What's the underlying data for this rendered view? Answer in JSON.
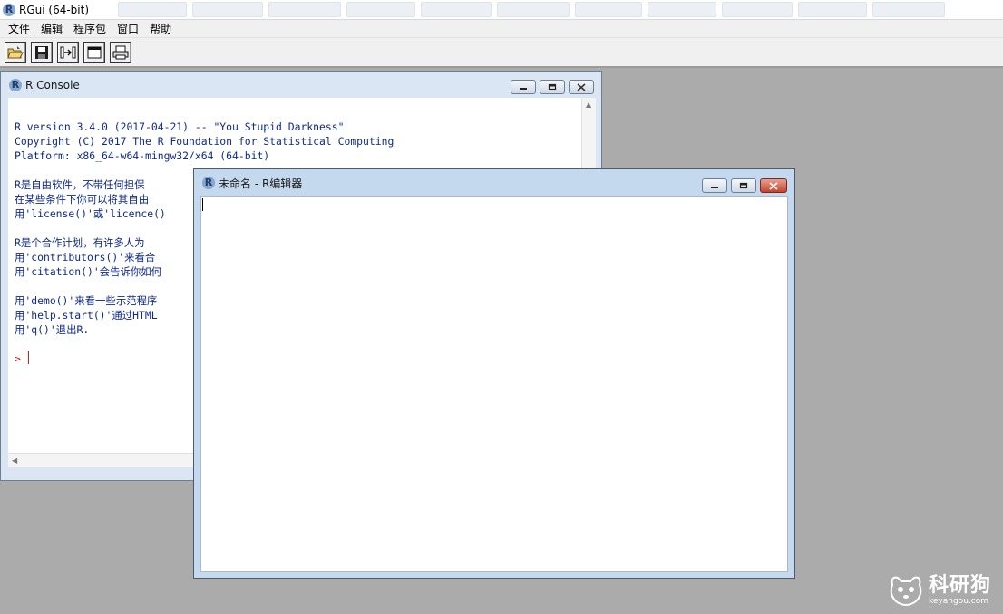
{
  "app": {
    "title": "RGui (64-bit)"
  },
  "menu": {
    "items": [
      "文件",
      "编辑",
      "程序包",
      "窗口",
      "帮助"
    ]
  },
  "toolbar": {
    "buttons": [
      "open-script-icon",
      "save-icon",
      "load-workspace-icon",
      "console-window-icon",
      "print-icon"
    ]
  },
  "console": {
    "title": "R Console",
    "lines": [
      "",
      "R version 3.4.0 (2017-04-21) -- \"You Stupid Darkness\"",
      "Copyright (C) 2017 The R Foundation for Statistical Computing",
      "Platform: x86_64-w64-mingw32/x64 (64-bit)",
      "",
      "R是自由软件，不带任何担保",
      "在某些条件下你可以将其自由",
      "用'license()'或'licence()",
      "",
      "R是个合作计划，有许多人为",
      "用'contributors()'来看合",
      "用'citation()'会告诉你如何",
      "",
      "用'demo()'来看一些示范程序",
      "用'help.start()'通过HTML",
      "用'q()'退出R.",
      ""
    ],
    "prompt": ">"
  },
  "editor": {
    "title": "未命名 - R编辑器"
  },
  "watermark": {
    "cn": "科研狗",
    "en": "keyangou.com"
  },
  "colors": {
    "console_text": "#0e2a8c",
    "prompt": "#c8201b",
    "mdi_background": "#ababab"
  }
}
